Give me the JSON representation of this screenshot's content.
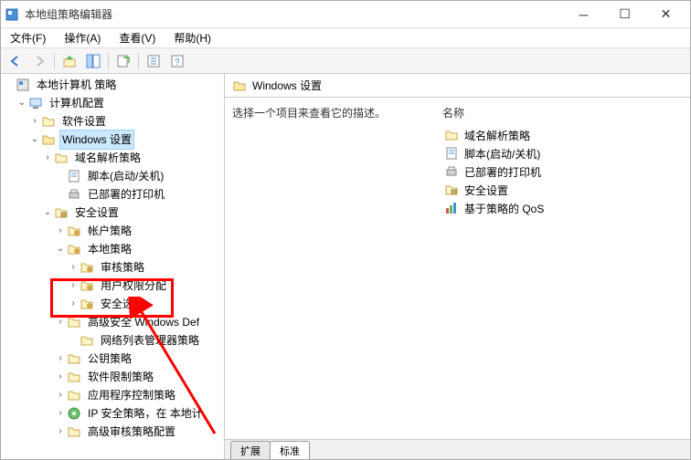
{
  "window": {
    "title": "本地组策略编辑器"
  },
  "menu": {
    "file": "文件(F)",
    "action": "操作(A)",
    "view": "查看(V)",
    "help": "帮助(H)"
  },
  "pathbar": {
    "title": "Windows 设置"
  },
  "content": {
    "desc": "选择一个项目来查看它的描述。",
    "name_col": "名称",
    "items": [
      "域名解析策略",
      "脚本(启动/关机)",
      "已部署的打印机",
      "安全设置",
      "基于策略的 QoS"
    ]
  },
  "tabs": {
    "extended": "扩展",
    "standard": "标准"
  },
  "tree": {
    "root": "本地计算机 策略",
    "comp_cfg": "计算机配置",
    "soft": "软件设置",
    "win": "Windows 设置",
    "dns": "域名解析策略",
    "script": "脚本(启动/关机)",
    "printer": "已部署的打印机",
    "sec": "安全设置",
    "acct": "帐户策略",
    "local": "本地策略",
    "audit": "审核策略",
    "rights": "用户权限分配",
    "secopts": "安全选项",
    "wdef": "高级安全 Windows Def",
    "netlist": "网络列表管理器策略",
    "pubkey": "公钥策略",
    "softrestrict": "软件限制策略",
    "appctrl": "应用程序控制策略",
    "ipsec": "IP 安全策略，在 本地计",
    "advaudit": "高级审核策略配置"
  }
}
